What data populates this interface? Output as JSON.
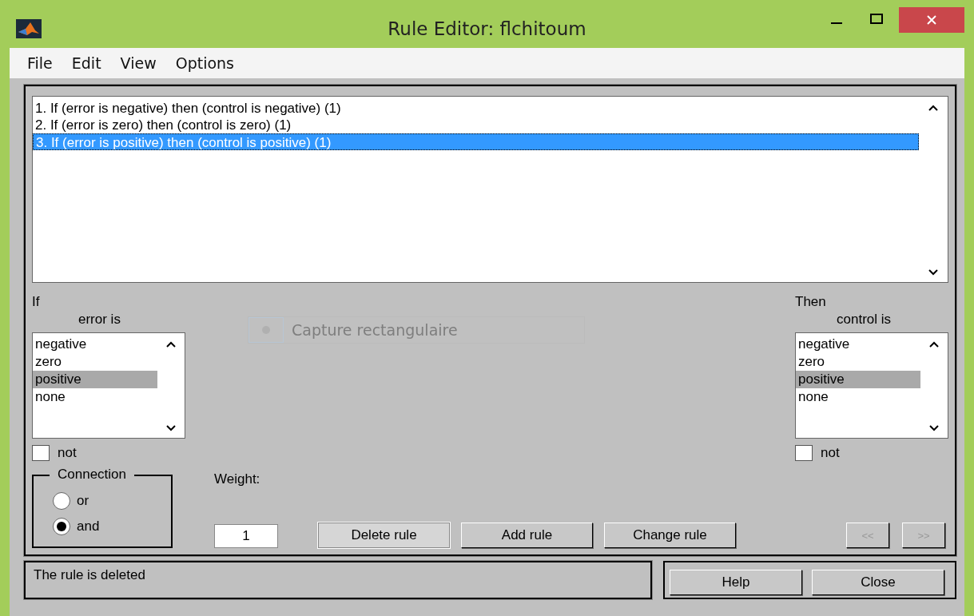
{
  "window": {
    "title": "Rule Editor: flchitoum"
  },
  "menu": [
    "File",
    "Edit",
    "View",
    "Options"
  ],
  "rules": [
    {
      "text": "1. If (error is negative) then (control is negative) (1)",
      "selected": false
    },
    {
      "text": "2. If (error is zero) then (control is zero) (1)",
      "selected": false
    },
    {
      "text": "3. If (error is positive) then (control is positive) (1)",
      "selected": true
    }
  ],
  "if_panel": {
    "heading": "If",
    "variable": "error is",
    "items": [
      {
        "label": "negative",
        "selected": false
      },
      {
        "label": "zero",
        "selected": false
      },
      {
        "label": "positive",
        "selected": true
      },
      {
        "label": "none",
        "selected": false
      }
    ],
    "not": {
      "label": "not",
      "checked": false
    }
  },
  "then_panel": {
    "heading": "Then",
    "variable": "control is",
    "items": [
      {
        "label": "negative",
        "selected": false
      },
      {
        "label": "zero",
        "selected": false
      },
      {
        "label": "positive",
        "selected": true
      },
      {
        "label": "none",
        "selected": false
      }
    ],
    "not": {
      "label": "not",
      "checked": false
    }
  },
  "overlay": {
    "label": "Capture rectangulaire"
  },
  "connection": {
    "title": "Connection",
    "options": [
      {
        "label": "or",
        "selected": false
      },
      {
        "label": "and",
        "selected": true
      }
    ]
  },
  "weight": {
    "label": "Weight:",
    "value": "1"
  },
  "buttons": [
    {
      "label": "Delete rule",
      "focused": true
    },
    {
      "label": "Add rule",
      "focused": false
    },
    {
      "label": "Change rule",
      "focused": false
    }
  ],
  "nav": [
    {
      "label": "<<",
      "disabled": true
    },
    {
      "label": ">>",
      "disabled": true
    }
  ],
  "status": "The rule is deleted",
  "footer_buttons": [
    "Help",
    "Close"
  ]
}
